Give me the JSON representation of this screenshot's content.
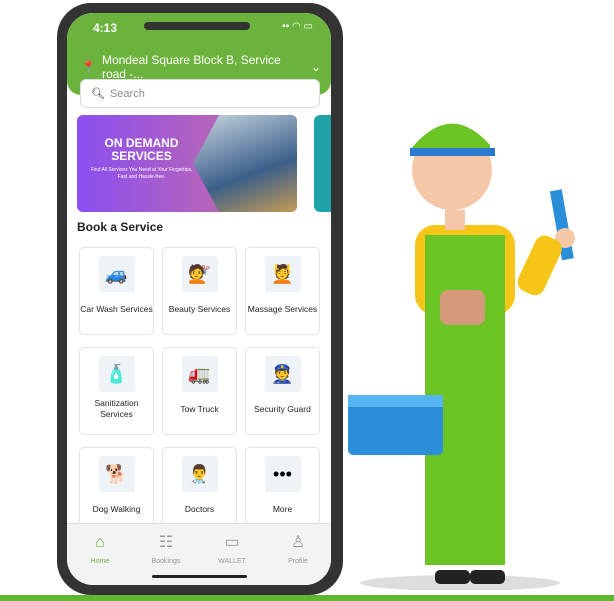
{
  "status": {
    "time": "4:13"
  },
  "location": {
    "address": "Mondeal Square Block B, Service road -..."
  },
  "search": {
    "placeholder": "Search"
  },
  "banner": {
    "title": "ON DEMAND SERVICES",
    "subtitle": "Find All Services You Need at Your Fingertips, Fast and Hassle-free."
  },
  "section_title": "Book a Service",
  "services": [
    {
      "label": "Car Wash Services",
      "icon": "🚙"
    },
    {
      "label": "Beauty Services",
      "icon": "💇"
    },
    {
      "label": "Massage Services",
      "icon": "💆"
    },
    {
      "label": "Sanitization Services",
      "icon": "🧴"
    },
    {
      "label": "Tow Truck",
      "icon": "🚛"
    },
    {
      "label": "Security Guard",
      "icon": "👮"
    },
    {
      "label": "Dog Walking",
      "icon": "🐕"
    },
    {
      "label": "Doctors",
      "icon": "👨‍⚕️"
    },
    {
      "label": "More",
      "icon": "•••"
    }
  ],
  "nav": [
    {
      "label": "Home",
      "icon": "⌂"
    },
    {
      "label": "Bookings",
      "icon": "☷"
    },
    {
      "label": "WALLET",
      "icon": "▭"
    },
    {
      "label": "Profile",
      "icon": "♙"
    }
  ],
  "colors": {
    "brand": "#6bb33c"
  }
}
